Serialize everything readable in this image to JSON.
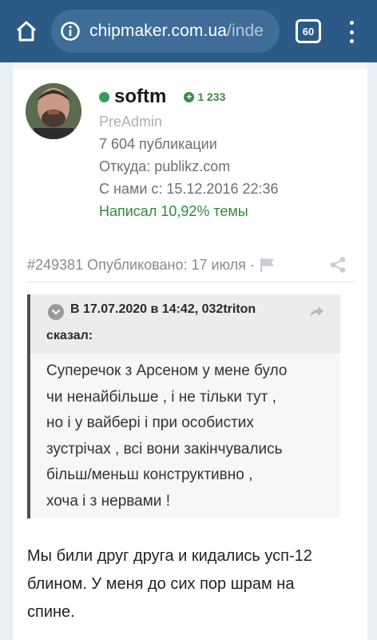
{
  "browser": {
    "url_main": "chipmaker.com.ua",
    "url_dim": "/inde",
    "tabs_count": "60"
  },
  "profile": {
    "username": "softm",
    "reputation": "1 233",
    "role": "PreAdmin",
    "posts": "7 604 публикации",
    "location": "Откуда: publikz.com",
    "joined": "С нами с: 15.12.2016 22:36",
    "topic_share": "Написал 10,92% темы"
  },
  "post": {
    "meta": "#249381 Опубликовано: 17 июля ·",
    "quote": {
      "cite_line1": "В 17.07.2020 в 14:42, 032triton",
      "cite_line2": "сказал:",
      "lines": [
        "Суперечок з Арсеном у мене було",
        "чи ненайбільше , і не тільки тут ,",
        "но і у вайбері і при особистих",
        "зустрічах , всі вони закінчувались",
        "більш/меньш конструктивно ,",
        "хоча і з нервами !"
      ]
    },
    "body_lines": [
      "Мы били друг друга и кидались усп-12",
      "блином. У меня до сих пор шрам на",
      "спине."
    ]
  },
  "colors": {
    "topbar": "#2b5a87",
    "online": "#2f9e5b",
    "accent_green": "#2f8a3a"
  }
}
